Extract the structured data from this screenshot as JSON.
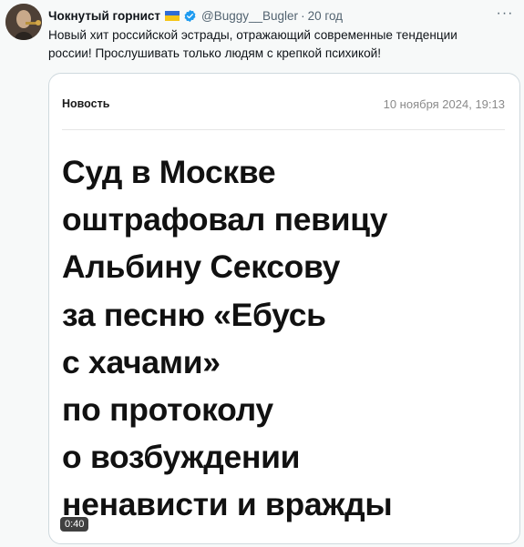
{
  "author": {
    "name": "Чокнутый горнист",
    "handle": "@Buggy__Bugler",
    "separator": "·",
    "time": "20 год",
    "flag": "ukraine-flag-icon",
    "verified": "verified-badge-icon"
  },
  "tweet": {
    "text": "Новый хит российской эстрады, отражающий современные тенденции россии! Прослушивать только людям с крепкой психикой!"
  },
  "media": {
    "label": "Новость",
    "date": "10 ноября 2024, 19:13",
    "headline_lines": [
      "Суд в Москве",
      "оштрафовал певицу",
      "Альбину Сексову",
      "за песню «Ебусь",
      "с хачами»",
      "по протоколу",
      "о возбуждении",
      "ненависти и вражды"
    ],
    "duration": "0:40"
  },
  "colors": {
    "background": "#f7f9f9",
    "secondary_text": "#536471",
    "verified": "#1d9bf0",
    "flag_blue": "#2f6cd6",
    "flag_yellow": "#f5c518"
  }
}
